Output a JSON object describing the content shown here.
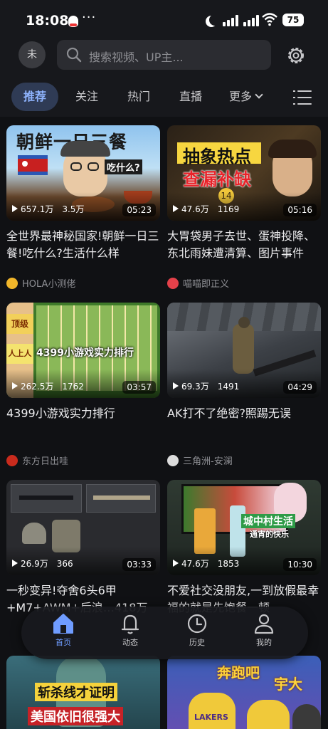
{
  "status_bar": {
    "time": "18:08",
    "dots": "···",
    "battery": "75"
  },
  "header": {
    "avatar_text": "未",
    "search_placeholder": "搜索视频、UP主..."
  },
  "tabs": [
    {
      "label": "推荐"
    },
    {
      "label": "关注"
    },
    {
      "label": "热门"
    },
    {
      "label": "直播"
    },
    {
      "label": "更多"
    }
  ],
  "videos": [
    {
      "overlay1": "朝鲜一日三餐",
      "overlay2": "吃什么?",
      "overlay3": "",
      "views": "657.1万",
      "likes": "3.5万",
      "duration": "05:23",
      "title": "全世界最神秘国家!朝鲜一日三餐!吃什么?生活什么样",
      "author": "HOLA小测佬"
    },
    {
      "overlay1": "抽象热点",
      "overlay2": "查漏补缺",
      "overlay3": "14",
      "views": "47.6万",
      "likes": "1169",
      "duration": "05:16",
      "title": "大胃袋男子去世、蛋神投降、东北雨妹遭清算、图片事件",
      "author": "喵喵即正义"
    },
    {
      "overlay1": "4399小游戏实力排行",
      "overlay2": "顶级",
      "overlay3": "人上人",
      "views": "262.5万",
      "likes": "1762",
      "duration": "03:57",
      "title": "4399小游戏实力排行",
      "author": "东方日出哇"
    },
    {
      "overlay1": "",
      "overlay2": "",
      "overlay3": "",
      "views": "69.3万",
      "likes": "1491",
      "duration": "04:29",
      "title": "AK打不了绝密?照踢无误",
      "author": "三角洲-安澜"
    },
    {
      "overlay1": "",
      "overlay2": "",
      "overlay3": "",
      "views": "26.9万",
      "likes": "366",
      "duration": "03:33",
      "title": "一秒变异!夺舍6头6甲+M7+AWM+后浪…418万",
      "author": ""
    },
    {
      "overlay1": "城中村生活",
      "overlay2": "通宵的快乐",
      "overlay3": "",
      "views": "47.6万",
      "likes": "1853",
      "duration": "10:30",
      "title": "不爱社交没朋友,一到放假最幸福的就是先饱餐一顿",
      "author": ""
    },
    {
      "overlay1": "斩杀线才证明",
      "overlay2": "美国依旧很强大",
      "overlay3": ""
    },
    {
      "overlay1": "奔跑吧",
      "overlay2": "宇大",
      "overlay3": "LAKERS"
    }
  ],
  "bottom_nav": [
    {
      "label": "首页",
      "icon": "home-icon"
    },
    {
      "label": "动态",
      "icon": "bell-icon"
    },
    {
      "label": "历史",
      "icon": "clock-icon"
    },
    {
      "label": "我的",
      "icon": "person-icon"
    }
  ],
  "colors": {
    "accent": "#6f9cff",
    "tab_active_bg": "#2f3b55",
    "background": "#101114"
  }
}
